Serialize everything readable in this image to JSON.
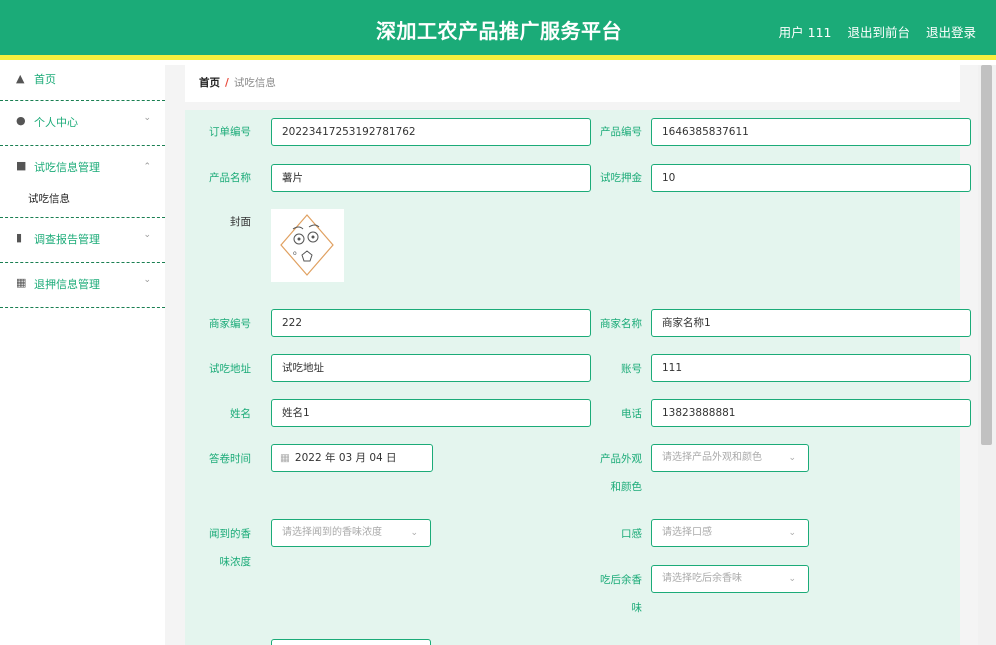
{
  "header": {
    "title": "深加工农产品推广服务平台",
    "user_label": "用户 111",
    "frontend_link": "退出到前台",
    "logout_link": "退出登录"
  },
  "sidebar": {
    "items": [
      {
        "label": "首页",
        "icon": "home-icon"
      },
      {
        "label": "个人中心",
        "icon": "user-icon"
      },
      {
        "label": "试吃信息管理",
        "icon": "briefcase-icon"
      },
      {
        "label": "调查报告管理",
        "icon": "document-icon"
      },
      {
        "label": "退押信息管理",
        "icon": "grid-icon"
      }
    ],
    "submenu_label": "试吃信息"
  },
  "breadcrumb": {
    "home": "首页",
    "separator": "/",
    "current": "试吃信息"
  },
  "form": {
    "order_no": {
      "label": "订单编号",
      "value": "20223417253192781762"
    },
    "product_no": {
      "label": "产品编号",
      "value": "1646385837611"
    },
    "product_name": {
      "label": "产品名称",
      "value": "薯片"
    },
    "deposit": {
      "label": "试吃押金",
      "value": "10"
    },
    "cover": {
      "label": "封面"
    },
    "merchant_no": {
      "label": "商家编号",
      "value": "222"
    },
    "merchant_name": {
      "label": "商家名称",
      "value": "商家名称1"
    },
    "address": {
      "label": "试吃地址",
      "value": "试吃地址"
    },
    "account": {
      "label": "账号",
      "value": "111"
    },
    "name": {
      "label": "姓名",
      "value": "姓名1"
    },
    "phone": {
      "label": "电话",
      "value": "13823888881"
    },
    "answer_time": {
      "label": "答卷时间",
      "value": "2022 年 03 月 04 日"
    },
    "appearance": {
      "label_line1": "产品外观",
      "label_line2": "和颜色",
      "placeholder": "请选择产品外观和颜色"
    },
    "aroma": {
      "label_line1": "闻到的香",
      "label_line2": "味浓度",
      "placeholder": "请选择闻到的香味浓度"
    },
    "taste": {
      "label": "口感",
      "placeholder": "请选择口感"
    },
    "aftertaste": {
      "label_line1": "吃后余香",
      "label_line2": "味",
      "placeholder": "请选择吃后余香味"
    }
  },
  "colors": {
    "primary": "#1bab78",
    "accent_bar": "#f6ee3f",
    "panel_bg": "#e4f5ee",
    "breadcrumb_sep": "#e84a3c"
  }
}
